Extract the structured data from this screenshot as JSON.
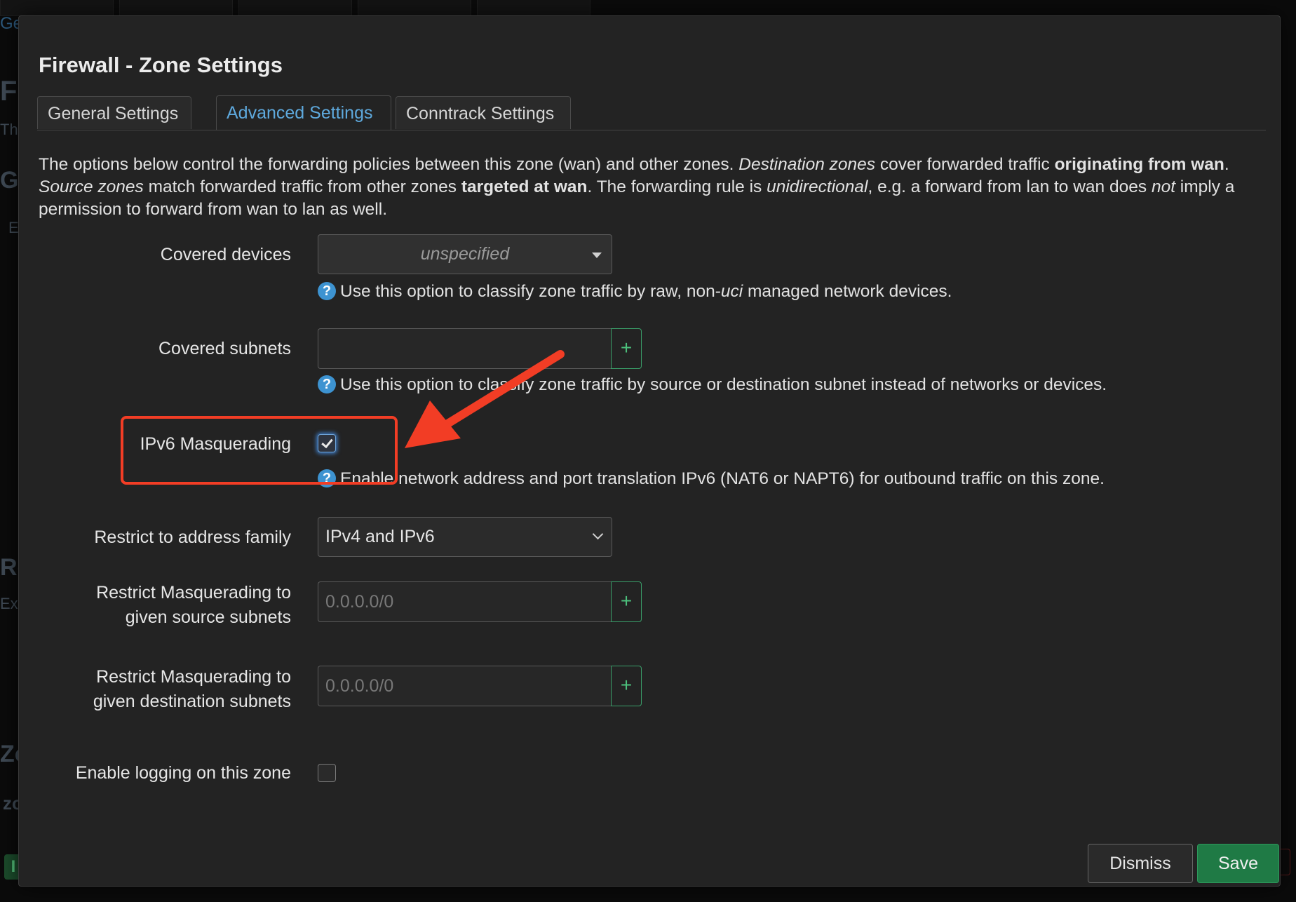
{
  "background": {
    "fragments": [
      "Ge",
      "Fi",
      "The",
      "Ge",
      "E",
      "Ro",
      "Exp",
      "Zo",
      "zo",
      "I"
    ]
  },
  "modal": {
    "title": "Firewall - Zone Settings",
    "tabs": [
      {
        "label": "General Settings",
        "active": false
      },
      {
        "label": "Advanced Settings",
        "active": true
      },
      {
        "label": "Conntrack Settings",
        "active": false
      }
    ],
    "description": {
      "p1": "The options below control the forwarding policies between this zone (wan) and other zones. ",
      "p2": "Destination zones",
      "p3": " cover forwarded traffic ",
      "p4": "originating from wan",
      "p5": ". ",
      "p6": "Source zones",
      "p7": " match forwarded traffic from other zones ",
      "p8": "targeted at wan",
      "p9": ". The forwarding rule is ",
      "p10": "unidirectional",
      "p11": ", e.g. a forward from lan to wan does ",
      "p12": "not",
      "p13": " imply a permission to forward from wan to lan as well."
    },
    "fields": {
      "covered_devices": {
        "label": "Covered devices",
        "value": "unspecified",
        "help_a": "Use this option to classify zone traffic by raw, non-",
        "help_b": "uci",
        "help_c": " managed network devices."
      },
      "covered_subnets": {
        "label": "Covered subnets",
        "value": "",
        "add": "+",
        "help": "Use this option to classify zone traffic by source or destination subnet instead of networks or devices."
      },
      "ipv6_masq": {
        "label": "IPv6 Masquerading",
        "checked": true,
        "help": "Enable network address and port translation IPv6 (NAT6 or NAPT6) for outbound traffic on this zone."
      },
      "address_family": {
        "label": "Restrict to address family",
        "value": "IPv4 and IPv6"
      },
      "masq_src": {
        "label_1": "Restrict Masquerading to",
        "label_2": "given source subnets",
        "placeholder": "0.0.0.0/0",
        "add": "+"
      },
      "masq_dest": {
        "label_1": "Restrict Masquerading to",
        "label_2": "given destination subnets",
        "placeholder": "0.0.0.0/0",
        "add": "+"
      },
      "logging": {
        "label": "Enable logging on this zone",
        "checked": false
      }
    },
    "buttons": {
      "dismiss": "Dismiss",
      "save": "Save"
    },
    "help_icon_glyph": "?"
  },
  "colors": {
    "accent": "#5ea9dd",
    "save": "#1f7a45",
    "annotation": "#f23d25"
  }
}
